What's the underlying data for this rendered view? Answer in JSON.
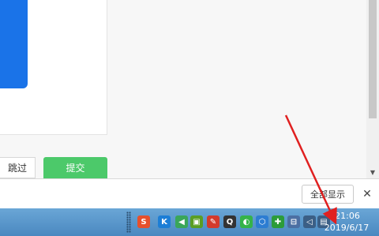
{
  "form": {
    "skip_label": "跳过",
    "submit_label": "提交"
  },
  "download_bar": {
    "show_all_label": "全部显示",
    "close_label": "✕"
  },
  "taskbar": {
    "time": "21:06",
    "date": "2019/6/17",
    "tray_icons": [
      {
        "name": "sogou-input-icon",
        "glyph": "S",
        "color": "#e6502c"
      },
      {
        "name": "kugou-icon",
        "glyph": "K",
        "color": "#1c7ed6"
      },
      {
        "name": "volume-green-icon",
        "glyph": "◀",
        "color": "#3aa65a"
      },
      {
        "name": "nvidia-icon",
        "glyph": "▣",
        "color": "#5a9e24"
      },
      {
        "name": "red-pen-icon",
        "glyph": "✎",
        "color": "#d33b2c"
      },
      {
        "name": "qq-icon",
        "glyph": "Q",
        "color": "#333333"
      },
      {
        "name": "wechat-icon",
        "glyph": "◐",
        "color": "#35b34a"
      },
      {
        "name": "shield-icon",
        "glyph": "⬡",
        "color": "#2d7dd2"
      },
      {
        "name": "security-icon",
        "glyph": "✚",
        "color": "#2c9c3a"
      },
      {
        "name": "usb-icon",
        "glyph": "⊟",
        "color": "#4c6fa3"
      },
      {
        "name": "speaker-icon",
        "glyph": "◁",
        "color": "#3b5f86"
      },
      {
        "name": "network-icon",
        "glyph": "▤",
        "color": "#3b5f86"
      }
    ]
  }
}
